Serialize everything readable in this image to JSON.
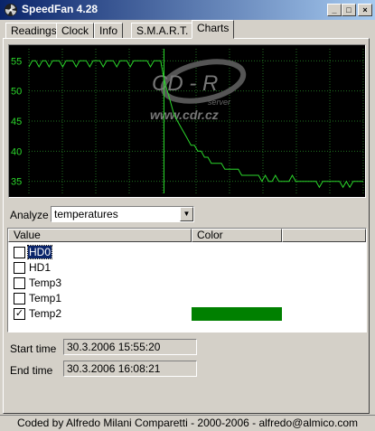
{
  "window": {
    "title": "SpeedFan 4.28"
  },
  "tabs": [
    {
      "label": "Readings"
    },
    {
      "label": "Clock"
    },
    {
      "label": "Info"
    },
    {
      "label": "S.M.A.R.T."
    },
    {
      "label": "Charts",
      "active": true
    }
  ],
  "chart_data": {
    "type": "line",
    "ylim": [
      33,
      57
    ],
    "y_ticks": [
      "55",
      "50",
      "45",
      "40",
      "35"
    ],
    "series": [
      {
        "color": "#2bd62b",
        "values": [
          54,
          55,
          55,
          54,
          55,
          55,
          54,
          55,
          55,
          55,
          54,
          55,
          55,
          55,
          54,
          55,
          55,
          55,
          54,
          55,
          55,
          55,
          54,
          55,
          55,
          55,
          54,
          55,
          55,
          55,
          54,
          55,
          55,
          55,
          55,
          55,
          54,
          55,
          55,
          55,
          52,
          50,
          48,
          46,
          45,
          44,
          43,
          42,
          41,
          41,
          40,
          40,
          39,
          39,
          38,
          38,
          38,
          38,
          37,
          37,
          37,
          37,
          37,
          36,
          36,
          36,
          36,
          36,
          36,
          35,
          36,
          35,
          35,
          36,
          35,
          35,
          35,
          35,
          36,
          35,
          35,
          35,
          35,
          35,
          35,
          35,
          34,
          35,
          35,
          35,
          35,
          35,
          35,
          34,
          35,
          34,
          35,
          35,
          35,
          35
        ]
      }
    ],
    "watermark": [
      "CD - R",
      "server",
      "www.cdr.cz"
    ]
  },
  "analyze": {
    "label": "Analyze",
    "value": "temperatures"
  },
  "list": {
    "columns": [
      "Value",
      "Color"
    ],
    "rows": [
      {
        "label": "HD0",
        "checked": false,
        "selected": true,
        "color": ""
      },
      {
        "label": "HD1",
        "checked": false,
        "color": ""
      },
      {
        "label": "Temp3",
        "checked": false,
        "color": ""
      },
      {
        "label": "Temp1",
        "checked": false,
        "color": ""
      },
      {
        "label": "Temp2",
        "checked": true,
        "color": "#008000"
      }
    ]
  },
  "start": {
    "label": "Start time",
    "value": "30.3.2006 15:55:20"
  },
  "end": {
    "label": "End time",
    "value": "30.3.2006 16:08:21"
  },
  "status": "Coded by Alfredo Milani Comparetti - 2000-2006 - alfredo@almico.com"
}
